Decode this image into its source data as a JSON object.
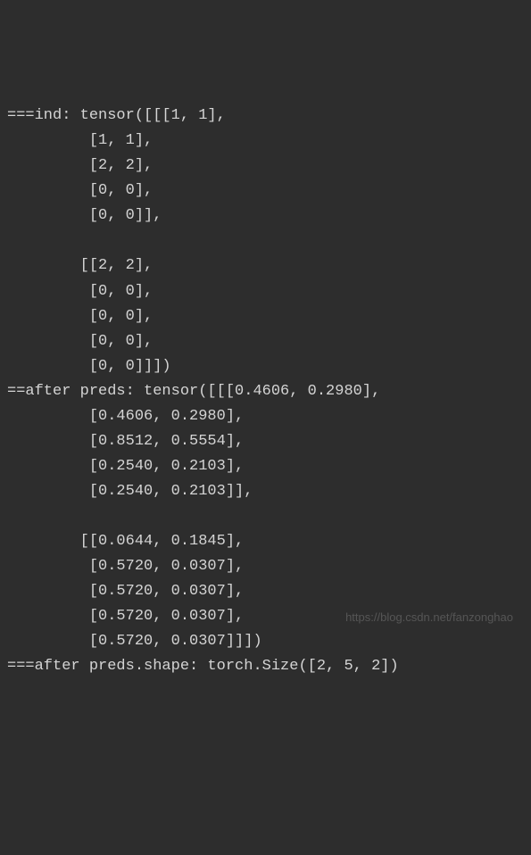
{
  "lines": {
    "l0": "===ind: tensor([[[1, 1],",
    "l1": "         [1, 1],",
    "l2": "         [2, 2],",
    "l3": "         [0, 0],",
    "l4": "         [0, 0]],",
    "l5": "",
    "l6": "        [[2, 2],",
    "l7": "         [0, 0],",
    "l8": "         [0, 0],",
    "l9": "         [0, 0],",
    "l10": "         [0, 0]]])",
    "l11": "==after preds: tensor([[[0.4606, 0.2980],",
    "l12": "         [0.4606, 0.2980],",
    "l13": "         [0.8512, 0.5554],",
    "l14": "         [0.2540, 0.2103],",
    "l15": "         [0.2540, 0.2103]],",
    "l16": "",
    "l17": "        [[0.0644, 0.1845],",
    "l18": "         [0.5720, 0.0307],",
    "l19": "         [0.5720, 0.0307],",
    "l20": "         [0.5720, 0.0307],",
    "l21": "         [0.5720, 0.0307]]])",
    "l22": "===after preds.shape: torch.Size([2, 5, 2])"
  },
  "watermark": "https://blog.csdn.net/fanzonghao"
}
